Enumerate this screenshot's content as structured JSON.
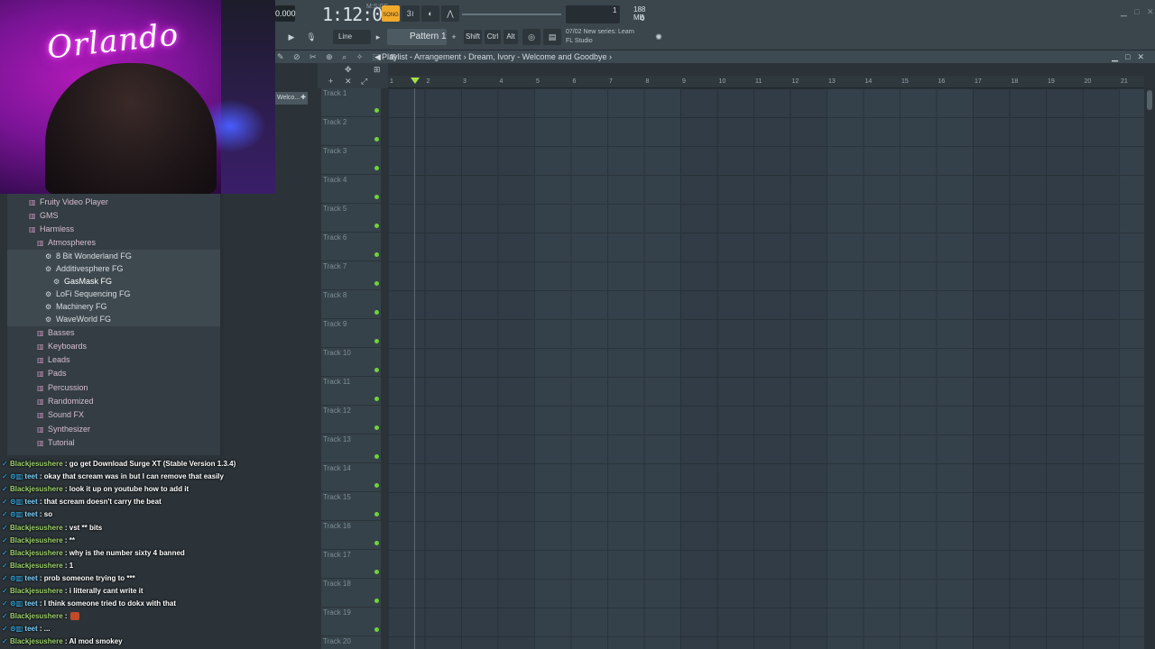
{
  "webcam": {
    "neon_text": "Orlando"
  },
  "toolbar": {
    "bpm": "0.000",
    "time": "1:12:08",
    "time_small": "M:S:CS",
    "song_btn": "SONG",
    "mode": "Line",
    "pattern": "Pattern 1",
    "cpu_value": "1",
    "mem_value": "188 MB",
    "poly_value": "0",
    "keys": [
      "Shift",
      "Ctrl",
      "Alt"
    ],
    "hint_line1": "07/02  New series: Learn",
    "hint_line2": "FL Studio"
  },
  "playlist": {
    "title": "Playlist - Arrangement",
    "breadcrumb_sep": "›",
    "song_name": "Dream, Ivory - Welcome and Goodbye",
    "pattern_tab": "Welco...",
    "ruler_ticks": [
      "1",
      "2",
      "3",
      "4",
      "5",
      "6",
      "7",
      "8",
      "9",
      "10",
      "11",
      "12",
      "13",
      "14",
      "15",
      "16",
      "17",
      "18",
      "19",
      "20",
      "21"
    ],
    "tracks": [
      "Track 1",
      "Track 2",
      "Track 3",
      "Track 4",
      "Track 5",
      "Track 6",
      "Track 7",
      "Track 8",
      "Track 9",
      "Track 10",
      "Track 11",
      "Track 12",
      "Track 13",
      "Track 14",
      "Track 15",
      "Track 16",
      "Track 17",
      "Track 18",
      "Track 19",
      "Track 20"
    ]
  },
  "browser": {
    "items": [
      {
        "label": "Fruity Video Player",
        "type": "folder",
        "indent": 0
      },
      {
        "label": "GMS",
        "type": "folder",
        "indent": 0
      },
      {
        "label": "Harmless",
        "type": "folder",
        "indent": 0
      },
      {
        "label": "Atmospheres",
        "type": "folder",
        "indent": 1
      },
      {
        "label": "8 Bit Wonderland FG",
        "type": "preset",
        "indent": 2
      },
      {
        "label": "Additivesphere FG",
        "type": "preset",
        "indent": 2
      },
      {
        "label": "GasMask FG",
        "type": "preset",
        "indent": 3
      },
      {
        "label": "LoFi Sequencing FG",
        "type": "preset",
        "indent": 2
      },
      {
        "label": "Machinery FG",
        "type": "preset",
        "indent": 2
      },
      {
        "label": "WaveWorld FG",
        "type": "preset",
        "indent": 2
      },
      {
        "label": "Basses",
        "type": "folder",
        "indent": 1
      },
      {
        "label": "Keyboards",
        "type": "folder",
        "indent": 1
      },
      {
        "label": "Leads",
        "type": "folder",
        "indent": 1
      },
      {
        "label": "Pads",
        "type": "folder",
        "indent": 1
      },
      {
        "label": "Percussion",
        "type": "folder",
        "indent": 1
      },
      {
        "label": "Randomized",
        "type": "folder",
        "indent": 1
      },
      {
        "label": "Sound FX",
        "type": "folder",
        "indent": 1
      },
      {
        "label": "Synthesizer",
        "type": "folder",
        "indent": 1
      },
      {
        "label": "Tutorial",
        "type": "folder",
        "indent": 1
      }
    ]
  },
  "chat": {
    "messages": [
      {
        "user": "Blackjesushere",
        "text": ": go get Download Surge XT (Stable Version 1.3.4)",
        "emote": false
      },
      {
        "user": "teet",
        "text": ": okay that scream was in but I can remove that easily",
        "emote": false
      },
      {
        "user": "Blackjesushere",
        "text": ": look it up on youtube how to add it",
        "emote": false
      },
      {
        "user": "teet",
        "text": ": that scream doesn't carry the beat",
        "emote": false
      },
      {
        "user": "teet",
        "text": ": so",
        "emote": false
      },
      {
        "user": "Blackjesushere",
        "text": ": vst ** bits",
        "emote": false
      },
      {
        "user": "Blackjesushere",
        "text": ": **",
        "emote": false
      },
      {
        "user": "Blackjesushere",
        "text": ": why is the number sixty 4 banned",
        "emote": false
      },
      {
        "user": "Blackjesushere",
        "text": ": 1",
        "emote": false
      },
      {
        "user": "teet",
        "text": ": prob someone trying to ***",
        "emote": false
      },
      {
        "user": "Blackjesushere",
        "text": ": i litterally cant write it",
        "emote": false
      },
      {
        "user": "teet",
        "text": ": I think someone tried to dokx with that",
        "emote": false
      },
      {
        "user": "Blackjesushere",
        "text": ":",
        "emote": true
      },
      {
        "user": "teet",
        "text": ": ...",
        "emote": false
      },
      {
        "user": "Blackjesushere",
        "text": ": AI mod smokey",
        "emote": false
      }
    ]
  },
  "colors": {
    "accent": "#f0a92a",
    "track_dot": "#6fd33c",
    "marker": "#a8e04a",
    "chat_user": "#9fd36e"
  }
}
